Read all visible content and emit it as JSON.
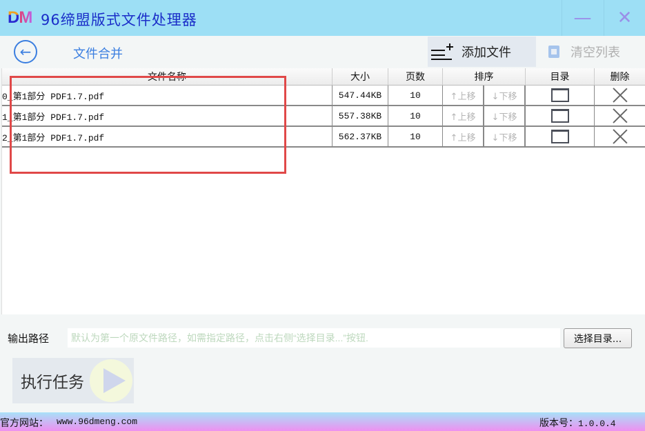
{
  "titlebar": {
    "logo_d": "D",
    "logo_m": "M",
    "title": "96缔盟版式文件处理器",
    "minimize": "—",
    "close": "✕"
  },
  "toolbar": {
    "back_icon": "←",
    "page_title": "文件合并",
    "add_label": "添加文件",
    "clear_label": "清空列表"
  },
  "table": {
    "headers": {
      "name": "文件名称",
      "size": "大小",
      "pages": "页数",
      "sort": "排序",
      "dir": "目录",
      "delete": "删除"
    },
    "up_label": "↑上移",
    "down_label": "↓下移",
    "rows": [
      {
        "name": "0_第1部分 PDF1.7.pdf",
        "size": "547.44KB",
        "pages": "10"
      },
      {
        "name": "1_第1部分 PDF1.7.pdf",
        "size": "557.38KB",
        "pages": "10"
      },
      {
        "name": "2_第1部分 PDF1.7.pdf",
        "size": "562.37KB",
        "pages": "10"
      }
    ]
  },
  "output": {
    "label": "输出路径",
    "value": "",
    "placeholder": "默认为第一个原文件路径，如需指定路径，点击右侧“选择目录...”按钮.",
    "choose_label": "选择目录..."
  },
  "run": {
    "label": "执行任务"
  },
  "status": {
    "site_label": "官方网站：",
    "site_url": "www.96dmeng.com",
    "version_label": "版本号：",
    "version": "1.0.0.4"
  },
  "colors": {
    "titlebar_bg": "#9ddff5",
    "accent_blue": "#3a7ee0",
    "highlight_red": "#e04848"
  }
}
